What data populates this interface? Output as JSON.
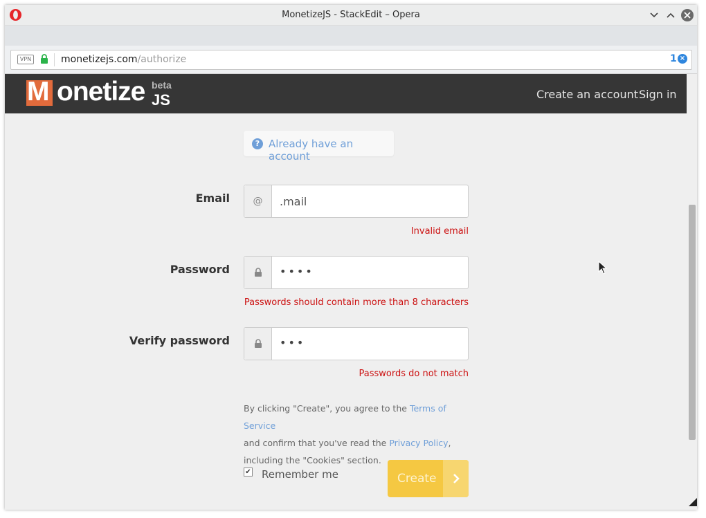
{
  "window": {
    "title": "MonetizeJS - StackEdit – Opera"
  },
  "address_bar": {
    "vpn_label": "VPN",
    "url_domain": "monetizejs.com",
    "url_path": "/authorize",
    "adblock_count": "1"
  },
  "header": {
    "logo_m": "M",
    "logo_rest": "onetize",
    "logo_beta": "beta",
    "logo_js": "JS",
    "nav": {
      "create_account": "Create an account",
      "sign_in": "Sign in"
    }
  },
  "form": {
    "already_account": "Already have an account",
    "email": {
      "label": "Email",
      "addon": "@",
      "value": ".mail",
      "error": "Invalid email"
    },
    "password": {
      "label": "Password",
      "value": "••••",
      "error": "Passwords should contain more than 8 characters"
    },
    "verify_password": {
      "label": "Verify password",
      "value": "•••",
      "error": "Passwords do not match"
    },
    "terms": {
      "part1": "By clicking \"Create\", you agree to the ",
      "tos_link": "Terms of Service",
      "part2": "and confirm that you've read the ",
      "privacy_link": "Privacy Policy",
      "part3": ",",
      "part4": "including the \"Cookies\" section."
    },
    "remember_me": "Remember me",
    "create_button": "Create"
  },
  "colors": {
    "header_bg": "#363636",
    "logo_accent": "#e26b3c",
    "error": "#cc1111",
    "link": "#6f9fd8",
    "button": "#f5c842"
  }
}
